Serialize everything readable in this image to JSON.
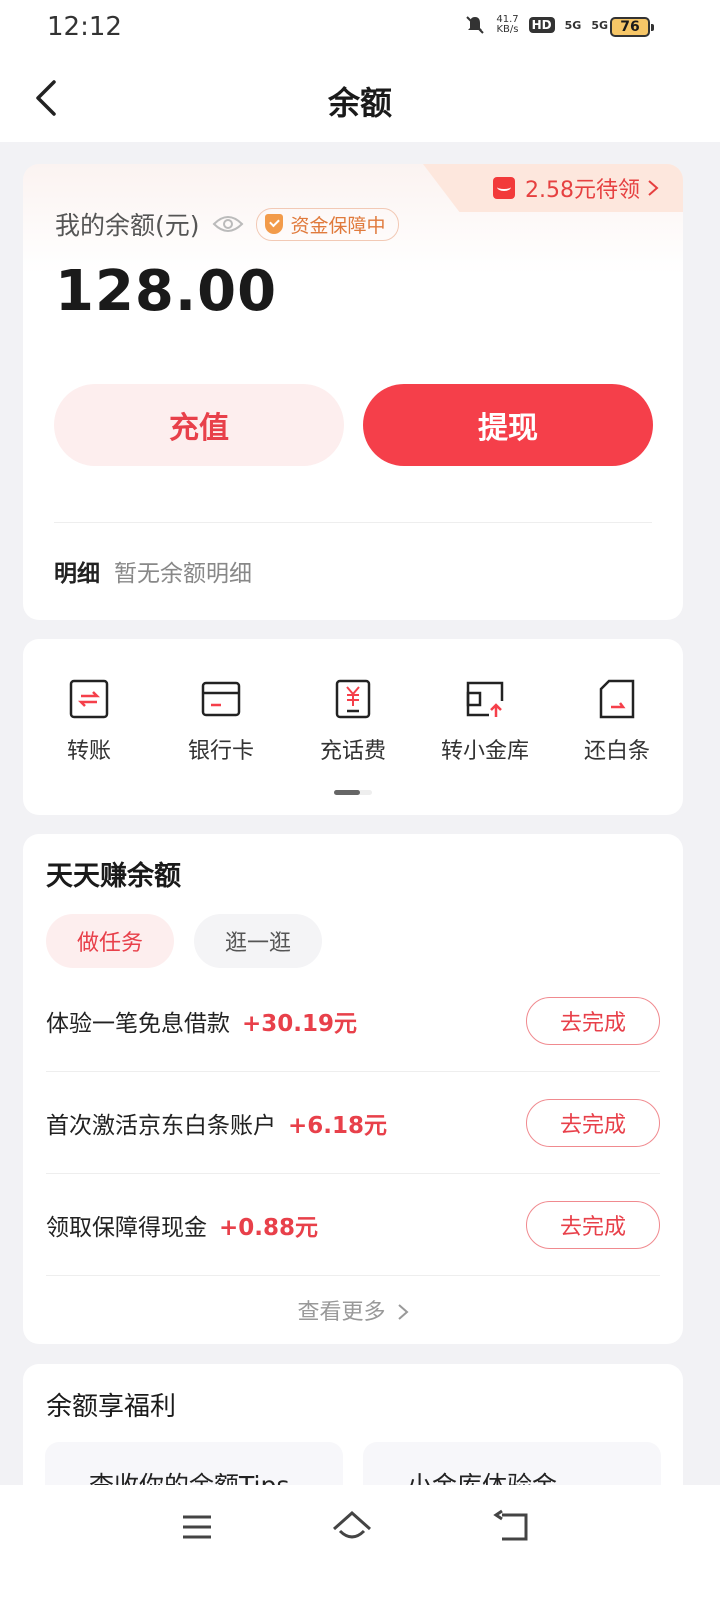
{
  "status_bar": {
    "time": "12:12",
    "net_speed": "41.7",
    "net_unit": "KB/s",
    "hd": "HD",
    "sig1": "5G",
    "sig2": "5G",
    "battery": "76"
  },
  "nav": {
    "title": "余额"
  },
  "balance": {
    "red_packet": "2.58元待领",
    "label": "我的余额(元)",
    "guard": "资金保障中",
    "amount": "128.00",
    "recharge": "充值",
    "withdraw": "提现",
    "detail_key": "明细",
    "detail_value": "暂无余额明细"
  },
  "tools": [
    {
      "label": "转账",
      "icon": "transfer-icon"
    },
    {
      "label": "银行卡",
      "icon": "bank-card-icon"
    },
    {
      "label": "充话费",
      "icon": "phone-bill-icon"
    },
    {
      "label": "转小金库",
      "icon": "vault-transfer-icon"
    },
    {
      "label": "还白条",
      "icon": "repay-icon"
    }
  ],
  "earn": {
    "title": "天天赚余额",
    "tabs": [
      "做任务",
      "逛一逛"
    ],
    "tasks": [
      {
        "name": "体验一笔免息借款",
        "reward": "+30.19元",
        "button": "去完成"
      },
      {
        "name": "首次激活京东白条账户",
        "reward": "+6.18元",
        "button": "去完成"
      },
      {
        "name": "领取保障得现金",
        "reward": "+0.88元",
        "button": "去完成"
      }
    ],
    "more": "查看更多"
  },
  "welfare": {
    "title": "余额享福利",
    "items": [
      "查收你的余额Tips",
      "小金库体验金"
    ]
  },
  "colors": {
    "accent": "#f53f4a",
    "accent_light": "#fdeeee",
    "background": "#f2f2f5"
  }
}
